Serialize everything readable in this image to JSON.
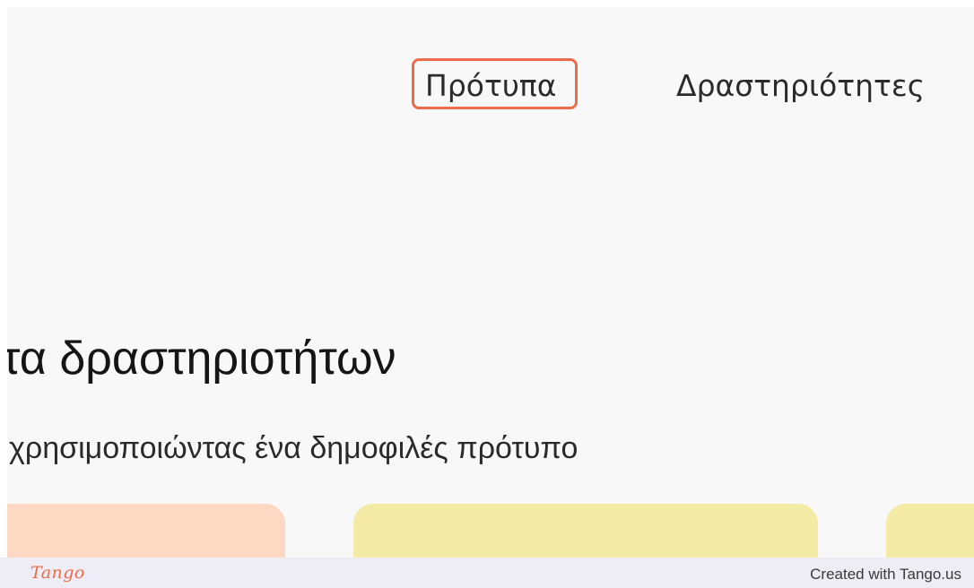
{
  "nav": {
    "items": [
      {
        "label": "Πρότυπα",
        "highlighted": true
      },
      {
        "label": "Δραστηριότητες",
        "highlighted": false
      }
    ]
  },
  "hero": {
    "title": "τα δραστηριοτήτων",
    "subtitle": "χρησιμοποιώντας ένα δημοφιλές πρότυπο"
  },
  "cards": [
    {
      "color": "#fdd9c3"
    },
    {
      "color": "#f3eba6"
    },
    {
      "color": "#f3eba6"
    }
  ],
  "footer": {
    "logo_text": "Tango",
    "credit": "Created with Tango.us"
  },
  "colors": {
    "highlight": "#ee6b4a",
    "background": "#f8f8f9",
    "footer_bg": "#eeecf4",
    "logo": "#ea6b49"
  }
}
